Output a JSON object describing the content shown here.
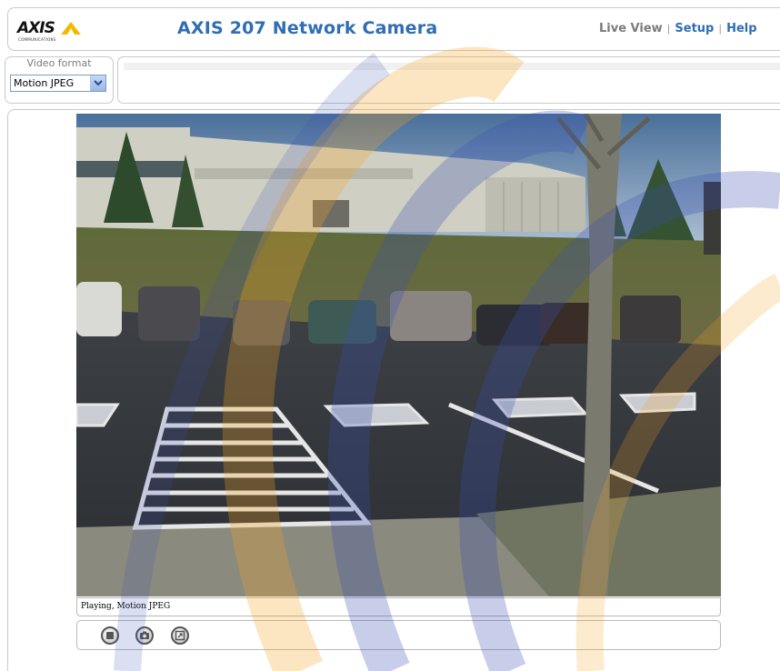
{
  "logo": {
    "brand": "AXIS",
    "subtext": "COMMUNICATIONS",
    "accent_color": "#f5b800"
  },
  "header": {
    "title": "AXIS 207 Network Camera",
    "title_color": "#2f6db4"
  },
  "nav": {
    "items": [
      {
        "label": "Live View",
        "active": true
      },
      {
        "label": "Setup",
        "active": false
      },
      {
        "label": "Help",
        "active": false
      }
    ],
    "separator": "|",
    "link_color": "#2f6db4"
  },
  "video_format": {
    "label": "Video format",
    "selected": "Motion JPEG"
  },
  "player": {
    "status": "Playing, Motion JPEG",
    "controls": [
      {
        "name": "stop",
        "icon": "stop-icon"
      },
      {
        "name": "snapshot",
        "icon": "camera-icon"
      },
      {
        "name": "fullscreen",
        "icon": "view-full-icon"
      }
    ]
  },
  "watermark_colors": {
    "orange": "#f5a623",
    "blue": "#3a4fb5"
  }
}
